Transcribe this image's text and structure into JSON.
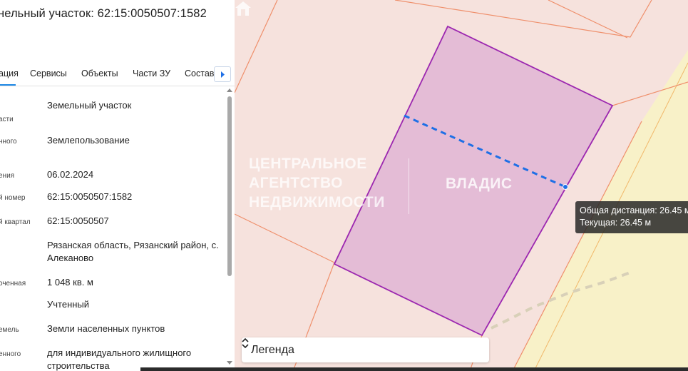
{
  "panel": {
    "title": "нельный участок: 62:15:0050507:1582",
    "tabs": [
      {
        "label": "ация",
        "active": true
      },
      {
        "label": "Сервисы"
      },
      {
        "label": "Объекты"
      },
      {
        "label": "Части ЗУ"
      },
      {
        "label": "Состав"
      }
    ],
    "rows": [
      {
        "label": "асти",
        "value": "Земельный участок"
      },
      {
        "label": "нного",
        "value": "Землепользование"
      },
      {
        "label": "ения",
        "value": "06.02.2024"
      },
      {
        "label": "й номер",
        "value": "62:15:0050507:1582"
      },
      {
        "label": "й квартал",
        "value": "62:15:0050507"
      },
      {
        "label": "",
        "value": "Рязанская область, Рязанский район, с. Алеканово"
      },
      {
        "label": "оченная",
        "value": "1 048 кв. м"
      },
      {
        "label": "",
        "value": "Учтенный"
      },
      {
        "label": "емель",
        "value": "Земли населенных пунктов"
      },
      {
        "label": "енного",
        "value": "для индивидуального жилищного строительства"
      }
    ]
  },
  "map": {
    "watermark_lines": [
      "ЦЕНТРАЛЬНОЕ",
      "АГЕНТСТВО",
      "НЕДВИЖИМОСТИ"
    ],
    "watermark_brand": "ВЛАДИС",
    "tooltip_total": "Общая дистанция: 26.45 м",
    "tooltip_current": "Текущая: 26.45 м",
    "legend_label": "Легенда",
    "colors": {
      "map_bg": "#f6e2dd",
      "parcel_fill": "#e4bcd6",
      "parcel_stroke": "#9c27b0",
      "boundary": "#ef8f6b",
      "measure_line": "#1e6fe6",
      "road_fill": "#f8f1c8"
    }
  }
}
